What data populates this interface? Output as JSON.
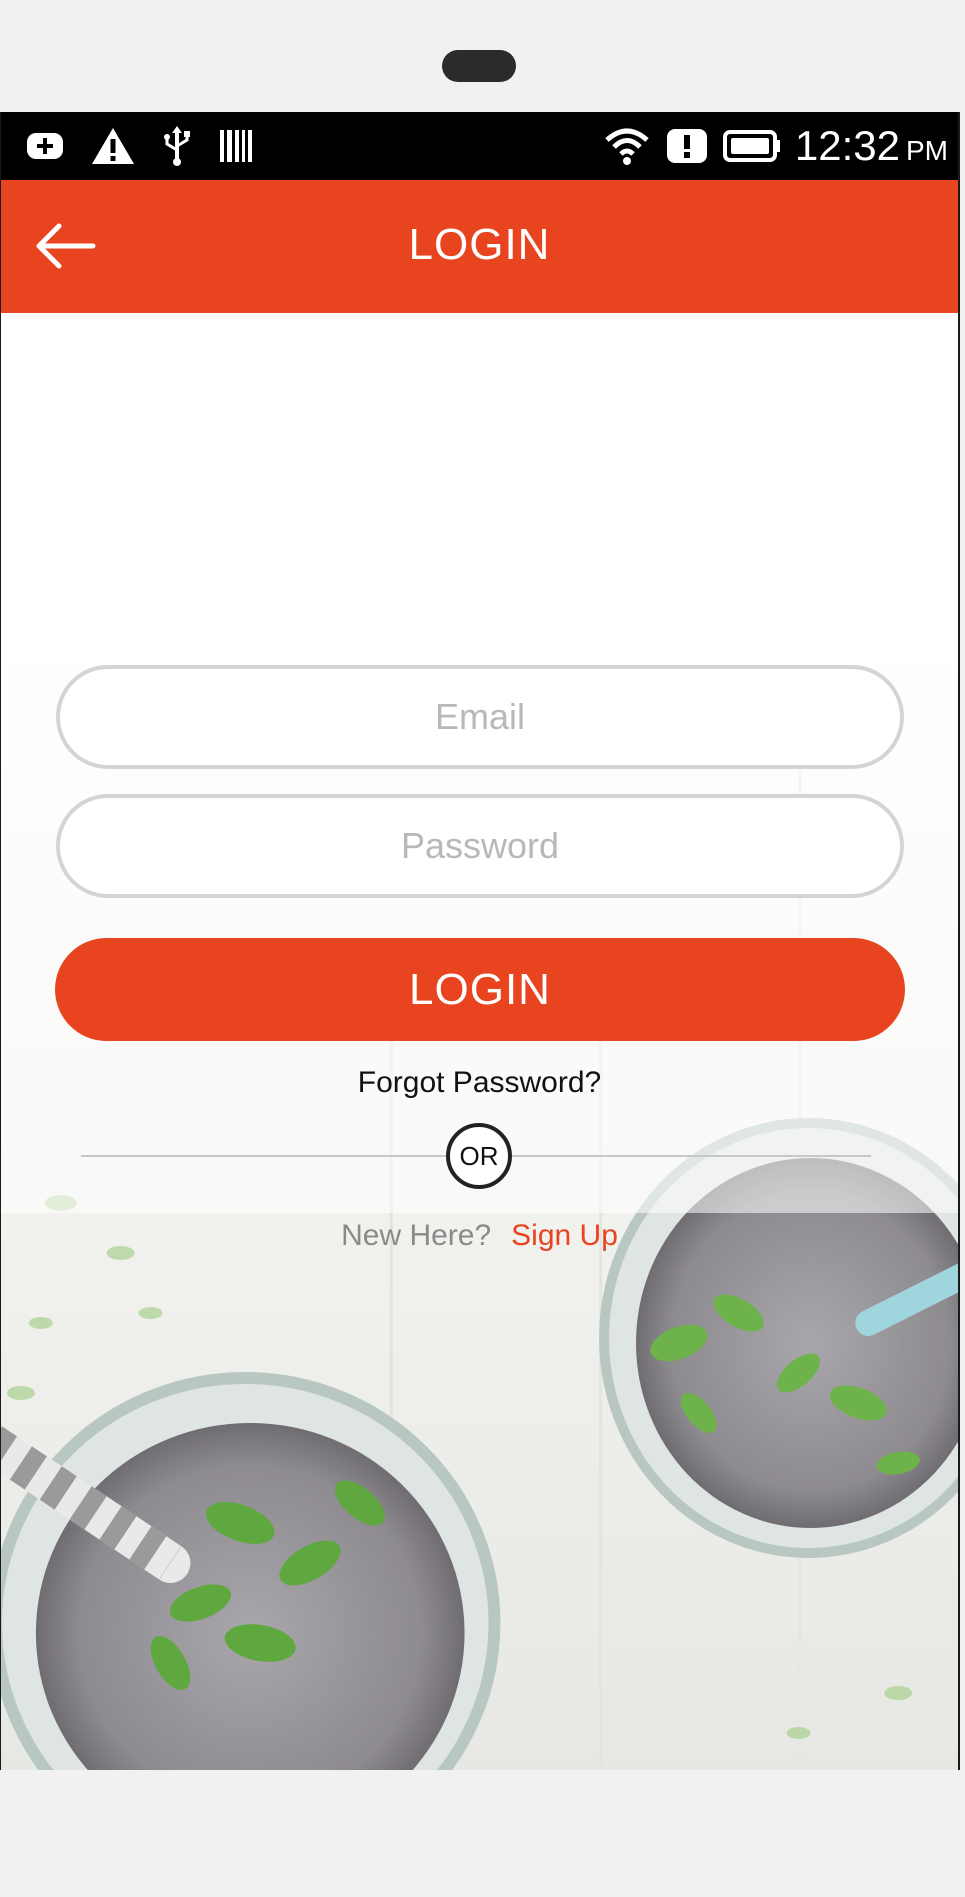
{
  "device": {
    "speaker_icon": "speaker-slot"
  },
  "status_bar": {
    "left_icons": [
      "add-notification-icon",
      "warning-icon",
      "usb-icon",
      "barcode-icon"
    ],
    "right_icons": [
      "wifi-icon",
      "alert-icon",
      "battery-icon"
    ],
    "time": "12:32",
    "ampm": "PM"
  },
  "app_bar": {
    "title": "LOGIN",
    "back_icon": "arrow-left-icon",
    "color": "#e8441f"
  },
  "form": {
    "email": {
      "value": "",
      "placeholder": "Email"
    },
    "password": {
      "value": "",
      "placeholder": "Password"
    },
    "login_label": "LOGIN",
    "forgot_label": "Forgot Password?",
    "or_label": "OR",
    "new_here_label": "New Here?",
    "signup_label": "Sign Up"
  },
  "background": {
    "description_icon": "smoothie-jars-image"
  }
}
